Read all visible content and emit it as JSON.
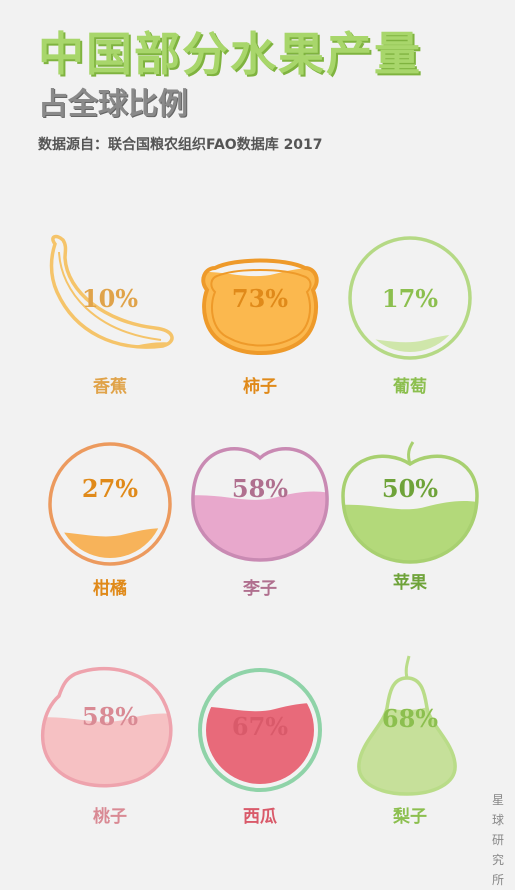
{
  "title": "中国部分水果产量",
  "subtitle": "占全球比例",
  "source": "数据源自：联合国粮农组织FAO数据库  2017",
  "credit": "星球研究所",
  "fruits": [
    {
      "name": "香蕉",
      "pct": "10%",
      "value": 10,
      "stroke": "#f5c46a",
      "fill": "#f5c46a",
      "text": "#e0a34a"
    },
    {
      "name": "柿子",
      "pct": "73%",
      "value": 73,
      "stroke": "#ee9a2a",
      "fill": "#fbb84e",
      "text": "#e08a1a"
    },
    {
      "name": "葡萄",
      "pct": "17%",
      "value": 17,
      "stroke": "#b5d985",
      "fill": "#cfe6aa",
      "text": "#8cbf4f"
    },
    {
      "name": "柑橘",
      "pct": "27%",
      "value": 27,
      "stroke": "#ec9a5e",
      "fill": "#f7b35a",
      "text": "#e08a1a"
    },
    {
      "name": "李子",
      "pct": "58%",
      "value": 58,
      "stroke": "#c98ab3",
      "fill": "#e8a8cc",
      "text": "#b0708f"
    },
    {
      "name": "苹果",
      "pct": "50%",
      "value": 50,
      "stroke": "#a8d070",
      "fill": "#b3d97a",
      "text": "#6fa33a"
    },
    {
      "name": "桃子",
      "pct": "58%",
      "value": 58,
      "stroke": "#eea3ad",
      "fill": "#f6c1c3",
      "text": "#d98a94"
    },
    {
      "name": "西瓜",
      "pct": "67%",
      "value": 67,
      "stroke": "#8fd3a8",
      "fill": "#e86a7a",
      "text": "#d95a6a"
    },
    {
      "name": "梨子",
      "pct": "68%",
      "value": 68,
      "stroke": "#b9dc88",
      "fill": "#c6e09a",
      "text": "#8cbf4f"
    }
  ]
}
